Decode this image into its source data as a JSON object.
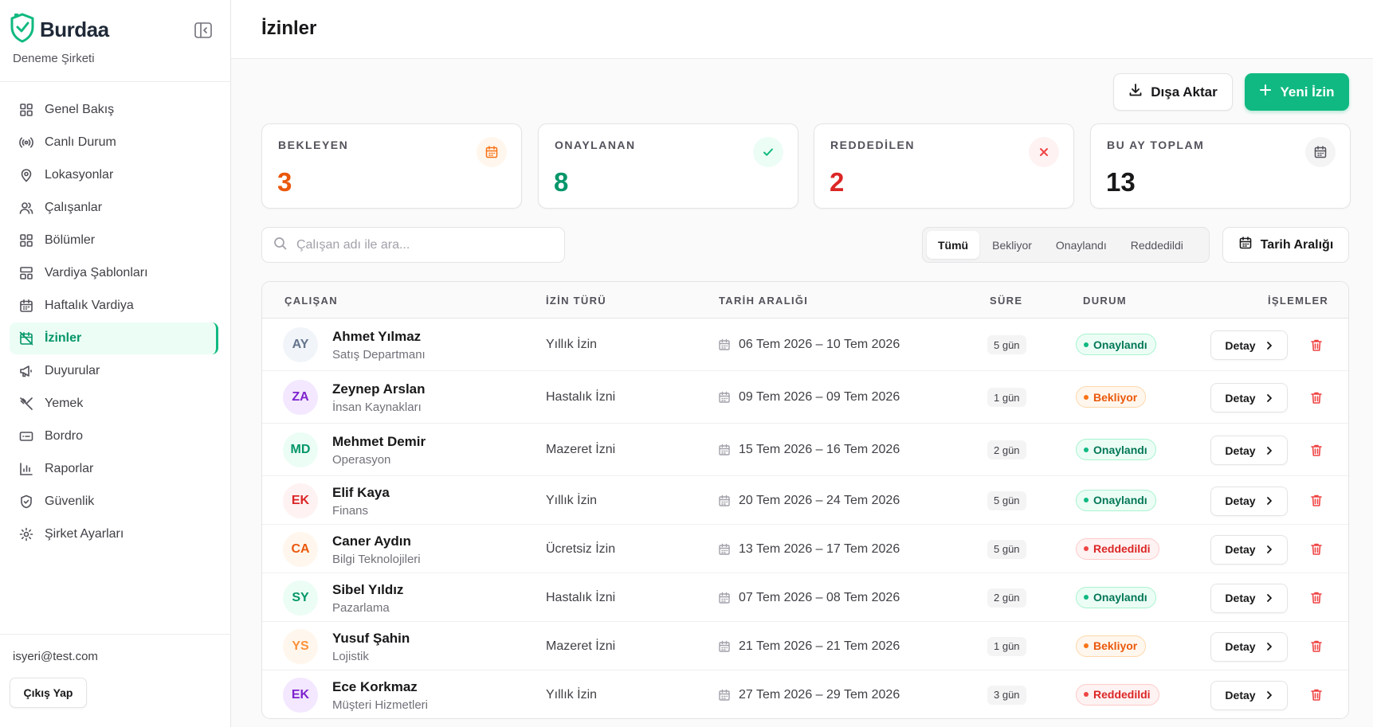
{
  "brand": {
    "name": "Burdaa",
    "company": "Deneme Şirketi"
  },
  "sidebar": {
    "items": [
      {
        "label": "Genel Bakış",
        "icon": "grid-icon",
        "active": false
      },
      {
        "label": "Canlı Durum",
        "icon": "broadcast-icon",
        "active": false
      },
      {
        "label": "Lokasyonlar",
        "icon": "map-pin-icon",
        "active": false
      },
      {
        "label": "Çalışanlar",
        "icon": "users-icon",
        "active": false
      },
      {
        "label": "Bölümler",
        "icon": "grid-icon",
        "active": false
      },
      {
        "label": "Vardiya Şablonları",
        "icon": "layout-template-icon",
        "active": false
      },
      {
        "label": "Haftalık Vardiya",
        "icon": "calendar-icon",
        "active": false
      },
      {
        "label": "İzinler",
        "icon": "calendar-off-icon",
        "active": true
      },
      {
        "label": "Duyurular",
        "icon": "megaphone-icon",
        "active": false
      },
      {
        "label": "Yemek",
        "icon": "utensils-icon",
        "active": false
      },
      {
        "label": "Bordro",
        "icon": "receipt-icon",
        "active": false
      },
      {
        "label": "Raporlar",
        "icon": "bar-chart-icon",
        "active": false
      },
      {
        "label": "Güvenlik",
        "icon": "shield-icon",
        "active": false
      },
      {
        "label": "Şirket Ayarları",
        "icon": "gear-icon",
        "active": false
      }
    ],
    "user_email": "isyeri@test.com",
    "logout_label": "Çıkış Yap"
  },
  "header": {
    "title": "İzinler"
  },
  "actions": {
    "export_label": "Dışa Aktar",
    "new_label": "Yeni İzin"
  },
  "stats": [
    {
      "label": "BEKLEYEN",
      "value": "3",
      "color": "#ea580c",
      "icon": "calendar-icon",
      "icon_bg": "#fff7ed"
    },
    {
      "label": "ONAYLANAN",
      "value": "8",
      "color": "#059669",
      "icon": "check-icon",
      "icon_bg": "#ecfdf5"
    },
    {
      "label": "REDDEDİLEN",
      "value": "2",
      "color": "#dc2626",
      "icon": "x-icon",
      "icon_bg": "#fef2f2"
    },
    {
      "label": "BU AY TOPLAM",
      "value": "13",
      "color": "#18181b",
      "icon": "calendar-icon",
      "icon_bg": "#f4f4f5"
    }
  ],
  "search": {
    "placeholder": "Çalışan adı ile ara..."
  },
  "filters": {
    "tabs": [
      "Tümü",
      "Bekliyor",
      "Onaylandı",
      "Reddedildi"
    ],
    "selected": "Tümü"
  },
  "date_range_label": "Tarih Aralığı",
  "table": {
    "columns": [
      "ÇALIŞAN",
      "İZİN TÜRÜ",
      "TARİH ARALIĞI",
      "SÜRE",
      "DURUM",
      "İŞLEMLER"
    ],
    "detail_label": "Detay",
    "rows": [
      {
        "initials": "AY",
        "name": "Ahmet Yılmaz",
        "dept": "Satış Departmanı",
        "type": "Yıllık İzin",
        "range": "06 Tem 2026 – 10 Tem 2026",
        "duration": "5 gün",
        "status": "Onaylandı",
        "status_kind": "ok",
        "avatar_bg": "#f1f5f9",
        "avatar_fg": "#64748b"
      },
      {
        "initials": "ZA",
        "name": "Zeynep Arslan",
        "dept": "İnsan Kaynakları",
        "type": "Hastalık İzni",
        "range": "09 Tem 2026 – 09 Tem 2026",
        "duration": "1 gün",
        "status": "Bekliyor",
        "status_kind": "pend",
        "avatar_bg": "#f3e8ff",
        "avatar_fg": "#7e22ce"
      },
      {
        "initials": "MD",
        "name": "Mehmet Demir",
        "dept": "Operasyon",
        "type": "Mazeret İzni",
        "range": "15 Tem 2026 – 16 Tem 2026",
        "duration": "2 gün",
        "status": "Onaylandı",
        "status_kind": "ok",
        "avatar_bg": "#ecfdf5",
        "avatar_fg": "#059669"
      },
      {
        "initials": "EK",
        "name": "Elif Kaya",
        "dept": "Finans",
        "type": "Yıllık İzin",
        "range": "20 Tem 2026 – 24 Tem 2026",
        "duration": "5 gün",
        "status": "Onaylandı",
        "status_kind": "ok",
        "avatar_bg": "#fef2f2",
        "avatar_fg": "#dc2626"
      },
      {
        "initials": "CA",
        "name": "Caner Aydın",
        "dept": "Bilgi Teknolojileri",
        "type": "Ücretsiz İzin",
        "range": "13 Tem 2026 – 17 Tem 2026",
        "duration": "5 gün",
        "status": "Reddedildi",
        "status_kind": "rej",
        "avatar_bg": "#fff7ed",
        "avatar_fg": "#ea580c"
      },
      {
        "initials": "SY",
        "name": "Sibel Yıldız",
        "dept": "Pazarlama",
        "type": "Hastalık İzni",
        "range": "07 Tem 2026 – 08 Tem 2026",
        "duration": "2 gün",
        "status": "Onaylandı",
        "status_kind": "ok",
        "avatar_bg": "#ecfdf5",
        "avatar_fg": "#059669"
      },
      {
        "initials": "YS",
        "name": "Yusuf Şahin",
        "dept": "Lojistik",
        "type": "Mazeret İzni",
        "range": "21 Tem 2026 – 21 Tem 2026",
        "duration": "1 gün",
        "status": "Bekliyor",
        "status_kind": "pend",
        "avatar_bg": "#fff7ed",
        "avatar_fg": "#fb923c"
      },
      {
        "initials": "EK",
        "name": "Ece Korkmaz",
        "dept": "Müşteri Hizmetleri",
        "type": "Yıllık İzin",
        "range": "27 Tem 2026 – 29 Tem 2026",
        "duration": "3 gün",
        "status": "Reddedildi",
        "status_kind": "rej",
        "avatar_bg": "#f3e8ff",
        "avatar_fg": "#7e22ce"
      }
    ]
  }
}
